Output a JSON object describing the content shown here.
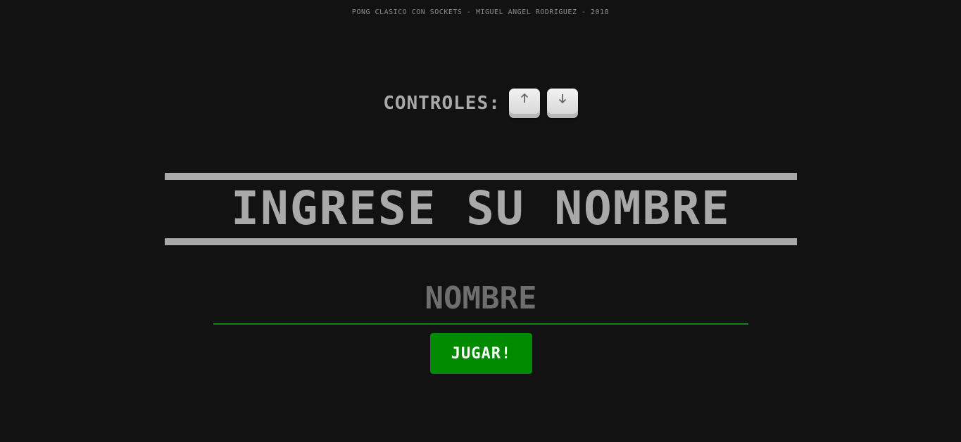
{
  "credit": "PONG CLASICO CON SOCKETS - MIGUEL ANGEL RODRIGUEZ - 2018",
  "controls": {
    "label": "CONTROLES:",
    "keys": [
      {
        "icon": "arrow-up-icon"
      },
      {
        "icon": "arrow-down-icon"
      }
    ]
  },
  "title": "INGRESE SU NOMBRE",
  "name_field": {
    "placeholder": "NOMBRE",
    "value": ""
  },
  "play_button": {
    "label": "JUGAR!"
  },
  "colors": {
    "background": "#121212",
    "text": "#a9a9a9",
    "accent": "#008a00"
  }
}
